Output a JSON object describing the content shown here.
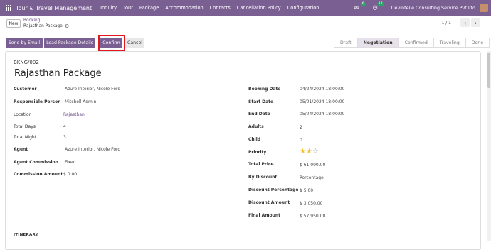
{
  "navbar": {
    "app_name": "Tour & Travel Management",
    "menu": [
      "Inquiry",
      "Tour",
      "Package",
      "Accommodation",
      "Contacts",
      "Cancellation Policy",
      "Configuration"
    ],
    "messages_count": "6",
    "activity_count": "17",
    "company": "Devintelle Consulting Service Pvt.Ltd",
    "bg_color": "#7a5f93"
  },
  "control": {
    "new_label": "New",
    "breadcrumb_parent": "Booking",
    "breadcrumb_current": "Rajasthan Package",
    "pager": "1 / 1"
  },
  "actions": {
    "send_email": "Send by Email",
    "load_details": "Load Package Details",
    "confirm": "Confirm",
    "cancel": "Cancel"
  },
  "statusbar": [
    "Draft",
    "Negotiation",
    "Confirmed",
    "Traveling",
    "Done"
  ],
  "statusbar_active": "Negotiation",
  "record": {
    "reference": "BKNG/002",
    "title": "Rajasthan Package"
  },
  "left_fields": [
    {
      "label": "Customer",
      "value": "Azure Interior, Nicole Ford"
    },
    {
      "label": "Responsible Person",
      "value": "Mitchell Admin"
    },
    {
      "label": "Location",
      "value": "Rajasthan"
    },
    {
      "label": "Total Days",
      "value": "4"
    },
    {
      "label": "Total Night",
      "value": "3"
    },
    {
      "label": "Agent",
      "value": "Azure Interior, Nicole Ford"
    },
    {
      "label": "Agent Commission",
      "value": "Fixed"
    },
    {
      "label": "Commission Amount",
      "value": "$ 0.00"
    }
  ],
  "right_fields": [
    {
      "label": "Booking Date",
      "value": "04/24/2024 18:00:00"
    },
    {
      "label": "Start Date",
      "value": "05/01/2024 18:00:00"
    },
    {
      "label": "End Date",
      "value": "05/04/2024 18:00:00"
    },
    {
      "label": "Adults",
      "value": "2"
    },
    {
      "label": "Child",
      "value": "0"
    },
    {
      "label": "Priority",
      "value": ""
    },
    {
      "label": "Total Price",
      "value": "$ 61,000.00"
    },
    {
      "label": "By Discount",
      "value": "Percentage"
    },
    {
      "label": "Discount Percentage",
      "value": "$ 5.00"
    },
    {
      "label": "Discount Amount",
      "value": "$ 3,050.00"
    },
    {
      "label": "Final Amount",
      "value": "$ 57,950.00"
    }
  ],
  "priority_stars": 2,
  "priority_max": 3,
  "section_itinerary": "ITINERARY"
}
